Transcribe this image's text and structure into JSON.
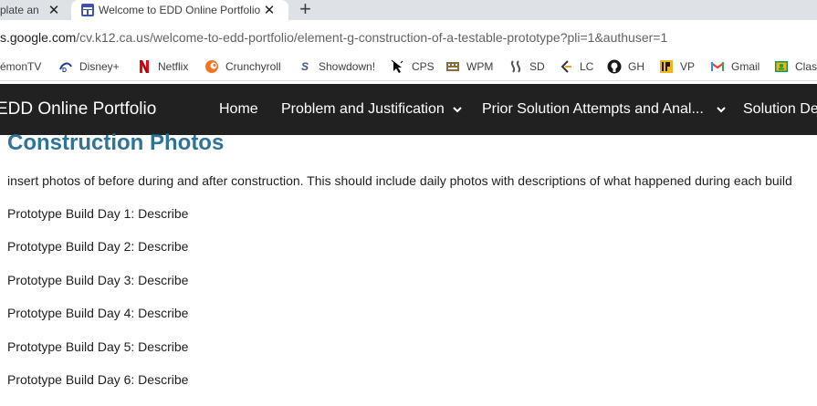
{
  "browser": {
    "tabs": [
      {
        "title": "plate an"
      },
      {
        "title": "Welcome to EDD Online Portfolio"
      }
    ],
    "close_glyph": "✕",
    "new_tab_glyph": "+",
    "url": {
      "host": "s.google.com",
      "path": "/cv.k12.ca.us/welcome-to-edd-portfolio/element-g-construction-of-a-testable-prototype?pli=1&authuser=1"
    },
    "bookmarks": [
      {
        "label": "kémonTV",
        "icon": "pokemon-icon"
      },
      {
        "label": "Disney+",
        "icon": "disney-icon"
      },
      {
        "label": "Netflix",
        "icon": "netflix-icon"
      },
      {
        "label": "Crunchyroll",
        "icon": "crunchyroll-icon"
      },
      {
        "label": "Showdown!",
        "icon": "showdown-icon"
      },
      {
        "label": "CPS",
        "icon": "cursor-icon"
      },
      {
        "label": "WPM",
        "icon": "keyboard-icon"
      },
      {
        "label": "SD",
        "icon": "sd-icon"
      },
      {
        "label": "LC",
        "icon": "lc-icon"
      },
      {
        "label": "GH",
        "icon": "github-icon"
      },
      {
        "label": "VP",
        "icon": "vp-icon"
      },
      {
        "label": "Gmail",
        "icon": "gmail-icon"
      },
      {
        "label": "Class",
        "icon": "classroom-icon"
      }
    ]
  },
  "site": {
    "title": "EDD Online Portfolio",
    "nav": [
      {
        "label": "Home",
        "has_dropdown": false
      },
      {
        "label": "Problem and Justification",
        "has_dropdown": true
      },
      {
        "label": "Prior Solution Attempts and Anal...",
        "has_dropdown": true
      },
      {
        "label": "Solution Des",
        "has_dropdown": false
      }
    ],
    "nav_bg": "#212121",
    "heading_color": "#2f7397"
  },
  "page": {
    "heading": "Construction Photos",
    "intro": "insert photos of before during and after construction.  This should include daily photos with descriptions of what happened during each build",
    "days": [
      "Prototype Build Day 1:  Describe",
      "Prototype Build Day 2:  Describe",
      "Prototype Build Day 3:  Describe",
      "Prototype Build Day 4:  Describe",
      "Prototype Build Day 5:  Describe",
      "Prototype Build Day 6:  Describe"
    ]
  }
}
